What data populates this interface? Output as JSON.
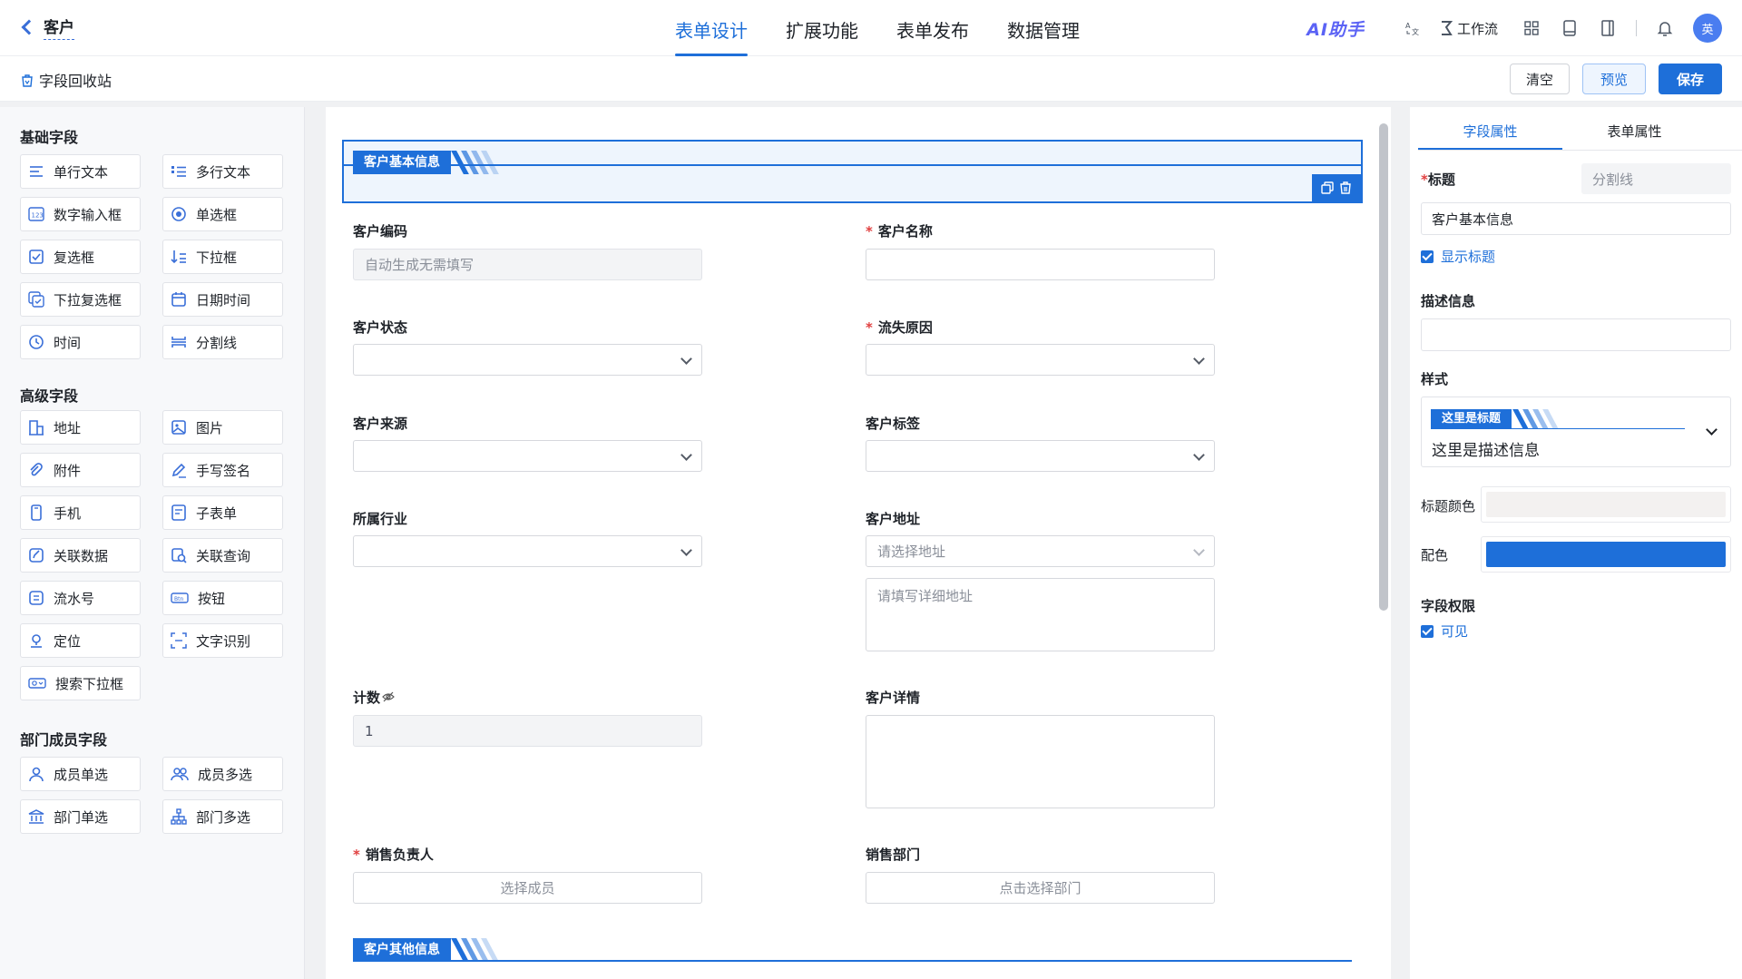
{
  "header": {
    "back_label": "客户",
    "tabs": [
      {
        "label": "表单设计",
        "active": true
      },
      {
        "label": "扩展功能",
        "active": false
      },
      {
        "label": "表单发布",
        "active": false
      },
      {
        "label": "数据管理",
        "active": false
      }
    ],
    "ai_label": "AI助手",
    "workflow_label": "工作流",
    "avatar_text": "英"
  },
  "toolbar": {
    "recycle_label": "字段回收站",
    "clear_label": "清空",
    "preview_label": "预览",
    "save_label": "保存"
  },
  "sidebar": {
    "basic_title": "基础字段",
    "basic": [
      "单行文本",
      "多行文本",
      "数字输入框",
      "单选框",
      "复选框",
      "下拉框",
      "下拉复选框",
      "日期时间",
      "时间",
      "分割线"
    ],
    "advanced_title": "高级字段",
    "advanced": [
      "地址",
      "图片",
      "附件",
      "手写签名",
      "手机",
      "子表单",
      "关联数据",
      "关联查询",
      "流水号",
      "按钮",
      "定位",
      "文字识别",
      "搜索下拉框"
    ],
    "dept_title": "部门成员字段",
    "dept": [
      "成员单选",
      "成员多选",
      "部门单选",
      "部门多选"
    ]
  },
  "form": {
    "section1_title": "客户基本信息",
    "section2_title": "客户其他信息",
    "fields": {
      "code_label": "客户编码",
      "code_value": "自动生成无需填写",
      "name_label": "客户名称",
      "status_label": "客户状态",
      "loss_label": "流失原因",
      "source_label": "客户来源",
      "tag_label": "客户标签",
      "industry_label": "所属行业",
      "address_label": "客户地址",
      "address_placeholder": "请选择地址",
      "address_detail_placeholder": "请填写详细地址",
      "count_label": "计数",
      "count_value": "1",
      "detail_label": "客户详情",
      "sales_label": "销售负责人",
      "sales_placeholder": "选择成员",
      "dept_label": "销售部门",
      "dept_placeholder": "点击选择部门"
    }
  },
  "props": {
    "tab_field": "字段属性",
    "tab_form": "表单属性",
    "title_label": "标题",
    "title_type": "分割线",
    "title_value": "客户基本信息",
    "show_title_label": "显示标题",
    "desc_label": "描述信息",
    "style_label": "样式",
    "style_preview_title": "这里是标题",
    "style_preview_desc": "这里是描述信息",
    "title_color_label": "标题颜色",
    "title_color_value": "#f3f1f0",
    "scheme_label": "配色",
    "scheme_color_value": "#1e6fd9",
    "perm_label": "字段权限",
    "visible_label": "可见"
  }
}
